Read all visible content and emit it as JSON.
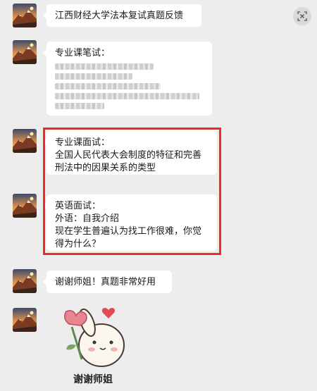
{
  "messages": [
    {
      "type": "text",
      "lines": [
        "江西财经大学法本复试真题反馈"
      ]
    },
    {
      "type": "blurred",
      "lines": [
        "专业课笔试："
      ]
    },
    {
      "type": "text",
      "lines": [
        "专业课面试：",
        "全国人民代表大会制度的特征和完善",
        "刑法中的因果关系的类型"
      ]
    },
    {
      "type": "text",
      "lines": [
        "英语面试：",
        "外语：自我介绍",
        "现在学生普遍认为找工作很难，你觉",
        "得为什么？"
      ]
    },
    {
      "type": "text",
      "lines": [
        "谢谢师姐！真题非常好用"
      ]
    },
    {
      "type": "sticker",
      "caption": "谢谢师姐"
    }
  ],
  "icons": {
    "top_right": "close-x-icon",
    "avatar": "mountain-sunset-avatar"
  },
  "colors": {
    "background": "#ededed",
    "bubble": "#ffffff",
    "highlight": "#ee2a2a"
  }
}
